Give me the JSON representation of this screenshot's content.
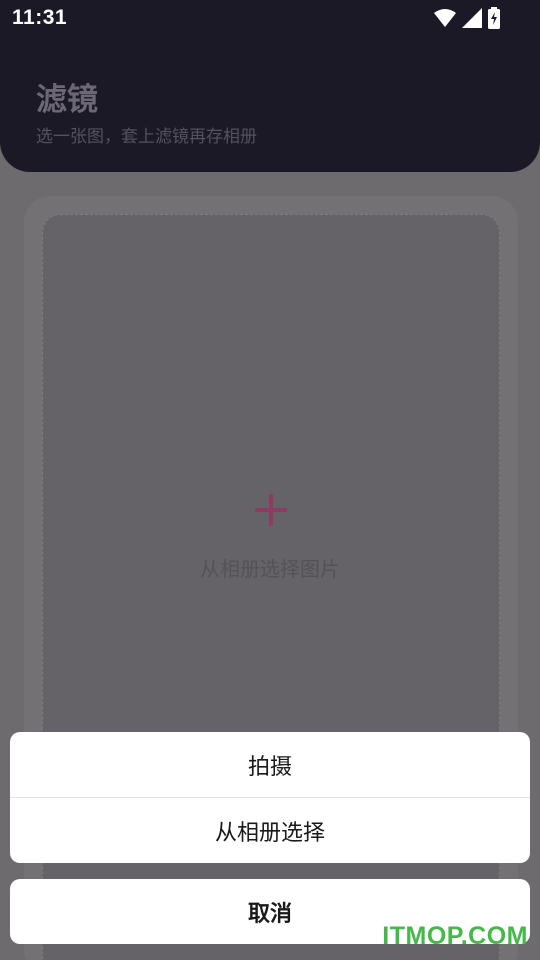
{
  "status_bar": {
    "time": "11:31",
    "icons": [
      "wifi-icon",
      "cellular-signal-icon",
      "battery-charging-icon"
    ]
  },
  "header": {
    "title": "滤镜",
    "subtitle": "选一张图，套上滤镜再存相册"
  },
  "picker": {
    "icon": "plus-icon",
    "label": "从相册选择图片"
  },
  "action_sheet": {
    "take_photo": "拍摄",
    "choose_from_album": "从相册选择",
    "cancel": "取消"
  },
  "watermark": "ITMOP.COM",
  "colors": {
    "header_bg": "#1c1927",
    "accent_plus": "#8c3b62",
    "overlay_bg": "#6e6b6e",
    "watermark": "#46b84a"
  }
}
